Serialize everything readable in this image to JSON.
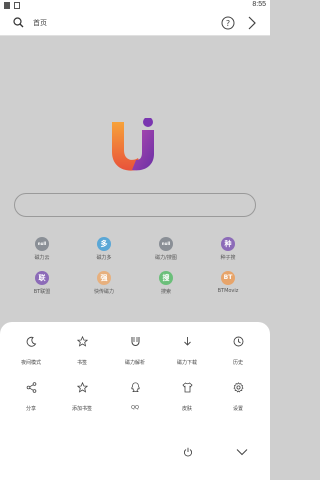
{
  "status": {
    "time": "8:55"
  },
  "header": {
    "title": "首页"
  },
  "colors": {
    "logo_gradient_start": "#f7a23a",
    "logo_gradient_mid": "#e8523a",
    "logo_purple": "#8a3fb5",
    "menu_bg": "#ffffff",
    "page_bg": "#cfcfcf"
  },
  "shortcuts": [
    {
      "glyph": "null",
      "label": "磁力云",
      "color": "#8a8f96",
      "icon": "null-icon"
    },
    {
      "glyph": "多",
      "label": "磁力多",
      "color": "#5aa7d6",
      "icon": "duo-icon"
    },
    {
      "glyph": "null",
      "label": "磁力/搜图",
      "color": "#8a8f96",
      "icon": "null-icon"
    },
    {
      "glyph": "种",
      "label": "种子搜",
      "color": "#8c6bb8",
      "icon": "zhong-icon"
    },
    {
      "glyph": "联",
      "label": "BT联盟",
      "color": "#8c6bb8",
      "icon": "lian-icon"
    },
    {
      "glyph": "强",
      "label": "快传磁力",
      "color": "#e7b07e",
      "icon": "qiang-icon"
    },
    {
      "glyph": "搜",
      "label": "搜索",
      "color": "#6bbf7a",
      "icon": "sou-icon"
    },
    {
      "glyph": "BT",
      "label": "BTMoviz",
      "color": "#e7a46a",
      "icon": "bt-icon"
    }
  ],
  "menu": [
    {
      "label": "夜间模式",
      "icon": "moon-icon"
    },
    {
      "label": "书签",
      "icon": "star-icon"
    },
    {
      "label": "磁力解析",
      "icon": "magnet-icon"
    },
    {
      "label": "磁力下载",
      "icon": "download-icon"
    },
    {
      "label": "历史",
      "icon": "clock-icon"
    },
    {
      "label": "分享",
      "icon": "share-icon"
    },
    {
      "label": "添加书签",
      "icon": "add-bookmark-icon"
    },
    {
      "label": "QQ",
      "icon": "qq-icon"
    },
    {
      "label": "皮肤",
      "icon": "shirt-icon"
    },
    {
      "label": "设置",
      "icon": "gear-icon"
    }
  ]
}
